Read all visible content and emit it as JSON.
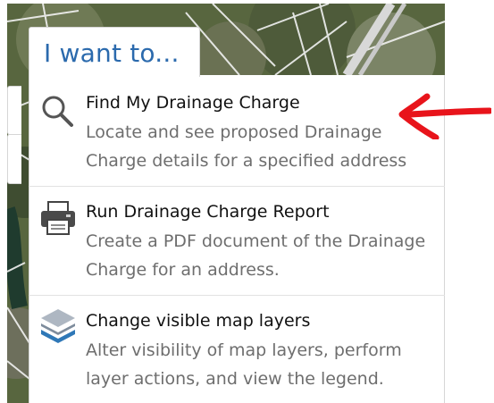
{
  "panel": {
    "title": "I want to..."
  },
  "items": [
    {
      "title": "Find My Drainage Charge",
      "description": "Locate and see proposed Drainage Charge details for a specified address",
      "icon": "search-icon"
    },
    {
      "title": "Run Drainage Charge Report",
      "description": "Create a PDF document of the Drainage Charge for an address.",
      "icon": "printer-icon"
    },
    {
      "title": "Change visible map layers",
      "description": "Alter visibility of map layers, perform layer actions, and view the legend.",
      "icon": "layers-icon"
    }
  ],
  "colors": {
    "title_blue": "#2b6aad",
    "annotation_red": "#e8141b",
    "layers_blue": "#2f78b7"
  },
  "annotation": {
    "icon": "red-arrow-annotation"
  }
}
